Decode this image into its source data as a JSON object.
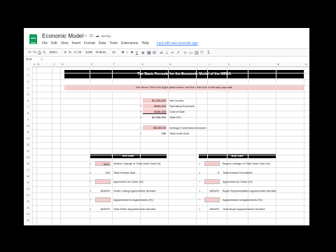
{
  "doc": {
    "title": "Economic Model",
    "saving": "Saving..."
  },
  "menu": [
    "File",
    "Edit",
    "View",
    "Insert",
    "Format",
    "Data",
    "Tools",
    "Extensions",
    "Help"
  ],
  "last_edit": "Last edit was seconds ago",
  "toolbar": {
    "zoom": "100%",
    "currency": "$",
    "percent": "%",
    "decimals": ".0 .00",
    "format": "123▾",
    "font": "Roboto",
    "font_size": "10"
  },
  "formula_bar": {
    "cell_ref": "D15",
    "fx": "fx"
  },
  "columns": [
    "A",
    "B",
    "C",
    "D",
    "E",
    "F",
    "G",
    "H",
    "I",
    "J",
    "K",
    "L",
    "M",
    "N"
  ],
  "rows": [
    "1",
    "2",
    "3",
    "4",
    "5",
    "6",
    "7",
    "8",
    "9",
    "10",
    "11",
    "12",
    "13",
    "14",
    "15",
    "16",
    "17",
    "18",
    "19",
    "20",
    "21",
    "22",
    "23",
    "24",
    "25",
    "26"
  ],
  "main_title": "The Basic Formula for the Economic Model of the MREA",
  "directions": "Directions: Fill in the highlighted boxes, and the other boxes will auto-populate",
  "top_block": [
    {
      "op": "",
      "value": "$1,000,000",
      "label": "Net Income"
    },
    {
      "op": "+",
      "value": "$300,000",
      "label": "Operating Expenses"
    },
    {
      "op": "+",
      "value": "$250,000",
      "label": "Cost of Sale"
    },
    {
      "op": "=",
      "value": "$1,550,000",
      "label": "Total GCI"
    },
    {
      "op": "÷",
      "value": "$8,000.00",
      "label": "Average Commission Amount"
    },
    {
      "op": "=",
      "value": "188",
      "label": "Total Units Sold"
    }
  ],
  "sell_side": {
    "header": "Sell Side",
    "rows": [
      {
        "op": "×",
        "value": "50%",
        "label": "Sellers Listings of Total Units Sold (%)"
      },
      {
        "op": "=",
        "value": "110",
        "label": "Total Homes Sold"
      },
      {
        "op": "÷",
        "value": "",
        "label": "Agreement to Close (%)"
      },
      {
        "op": "=",
        "value": "#DIV/0!",
        "label": "Seller Listing Agreements Needed"
      },
      {
        "op": "÷",
        "value": "",
        "label": "Appointment to Agreements (%)"
      },
      {
        "op": "=",
        "value": "#DIV/0!",
        "label": "Total Seller Appointments Needed"
      }
    ]
  },
  "buy_side": {
    "header": "Buy Side",
    "rows": [
      {
        "op": "×",
        "value": "",
        "label": "Buyers Listings of Total Units Sold (%)"
      },
      {
        "op": "=",
        "value": "0",
        "label": "Total Homes Purchased"
      },
      {
        "op": "÷",
        "value": "",
        "label": "Agreement to Close (%)"
      },
      {
        "op": "=",
        "value": "#DIV/0!",
        "label": "Buyer Representation Agreements Needed"
      },
      {
        "op": "÷",
        "value": "",
        "label": "Appointment to Agreements (%)"
      },
      {
        "op": "=",
        "value": "#DIV/0!",
        "label": "Total Buyer Appointments Needed"
      }
    ]
  }
}
